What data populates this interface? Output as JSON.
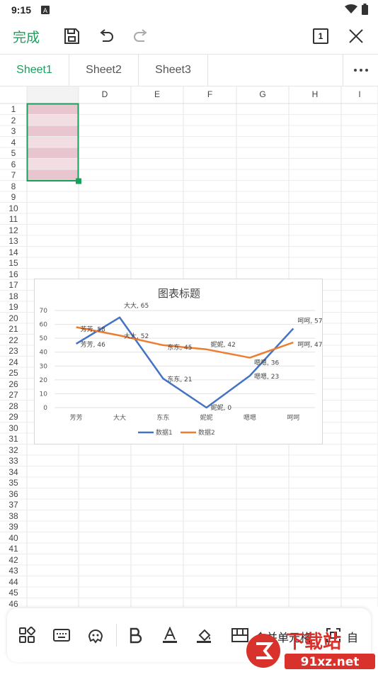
{
  "status": {
    "time": "9:15"
  },
  "toolbar": {
    "done_label": "完成",
    "page_count": "1"
  },
  "tabs": [
    {
      "label": "Sheet1",
      "active": true
    },
    {
      "label": "Sheet2",
      "active": false
    },
    {
      "label": "Sheet3",
      "active": false
    }
  ],
  "columns": [
    "D",
    "E",
    "F",
    "G",
    "H",
    "I"
  ],
  "rows": [
    "1",
    "2",
    "3",
    "4",
    "5",
    "6",
    "7",
    "8",
    "9",
    "10",
    "11",
    "12",
    "13",
    "14",
    "15",
    "16",
    "17",
    "18",
    "19",
    "20",
    "21",
    "22",
    "23",
    "24",
    "25",
    "26",
    "27",
    "28",
    "29",
    "30",
    "31",
    "32",
    "33",
    "34",
    "35",
    "36",
    "37",
    "38",
    "39",
    "40",
    "41",
    "42",
    "43",
    "44",
    "45",
    "46"
  ],
  "bottom_toolbar": {
    "merge_label": "合并单元格",
    "extra_label": "自"
  },
  "chart_data": {
    "type": "line",
    "title": "图表标题",
    "categories": [
      "芳芳",
      "大大",
      "东东",
      "妮妮",
      "嗯嗯",
      "呵呵"
    ],
    "ylim": [
      0,
      70
    ],
    "yticks": [
      "0",
      "10",
      "20",
      "30",
      "40",
      "50",
      "60",
      "70"
    ],
    "series": [
      {
        "name": "数据1",
        "color": "#4472c4",
        "values": [
          46,
          65,
          21,
          0,
          23,
          57
        ],
        "labels": [
          "芳芳, 46",
          "大大, 65",
          "东东, 21",
          "妮妮, 0",
          "嗯嗯, 23",
          "呵呵, 57"
        ]
      },
      {
        "name": "数据2",
        "color": "#ed7d31",
        "values": [
          58,
          52,
          45,
          42,
          36,
          47
        ],
        "labels": [
          "芳芳, 58",
          "大大, 52",
          "东东, 45",
          "妮妮, 42",
          "嗯嗯, 36",
          "呵呵, 47"
        ]
      }
    ],
    "legend": "bottom",
    "grid": true
  },
  "watermark": {
    "text_main": "下载站",
    "text_url": "91xz.net"
  },
  "colors": {
    "accent": "#1a9f5c",
    "selection_fill": "#e8c5cf",
    "selection_alt": "#f1dde2"
  }
}
